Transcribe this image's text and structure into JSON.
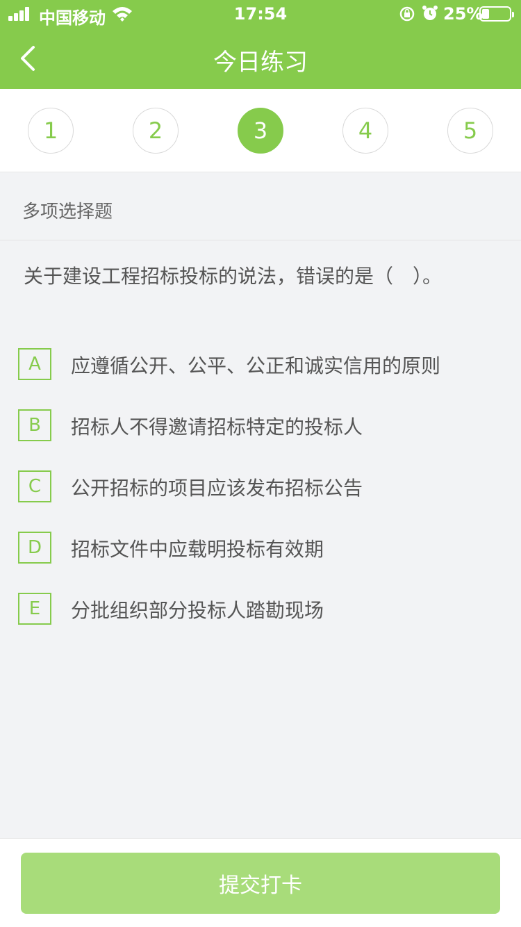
{
  "status_bar": {
    "carrier": "中国移动",
    "time": "17:54",
    "battery_percent": "25%",
    "battery_level": 0.25
  },
  "nav": {
    "title": "今日练习",
    "back_icon": "chevron-left-icon"
  },
  "tabs": {
    "items": [
      "1",
      "2",
      "3",
      "4",
      "5"
    ],
    "active_index": 2
  },
  "question": {
    "type": "多项选择题",
    "stem": "关于建设工程招标投标的说法，错误的是（　）。",
    "options": [
      {
        "letter": "A",
        "text": "应遵循公开、公平、公正和诚实信用的原则"
      },
      {
        "letter": "B",
        "text": "招标人不得邀请招标特定的投标人"
      },
      {
        "letter": "C",
        "text": "公开招标的项目应该发布招标公告"
      },
      {
        "letter": "D",
        "text": "招标文件中应载明投标有效期"
      },
      {
        "letter": "E",
        "text": "分批组织部分投标人踏勘现场"
      }
    ]
  },
  "footer": {
    "submit_label": "提交打卡"
  },
  "colors": {
    "primary": "#86cb4c",
    "submit_disabled": "#a8dc7a",
    "background": "#f2f3f5"
  }
}
